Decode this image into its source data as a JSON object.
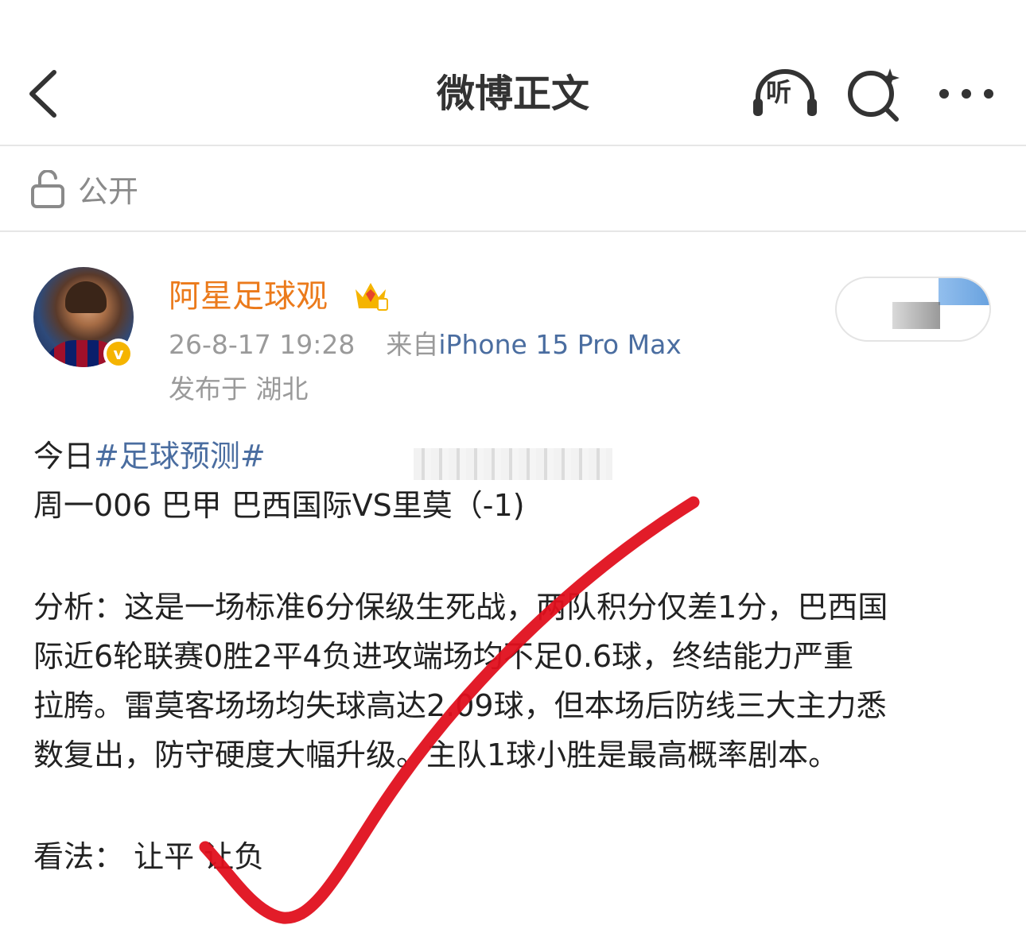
{
  "header": {
    "title": "微博正文",
    "listen_label": "听"
  },
  "visibility": {
    "label": "公开"
  },
  "post": {
    "author": "阿星足球观",
    "timestamp": "26-8-17 19:28",
    "source_prefix": "来自",
    "device": "iPhone 15 Pro Max",
    "location": "发布于 湖北",
    "intro_prefix": "今日",
    "hashtag": "#足球预测#",
    "match_line": "周一006 巴甲  巴西国际VS里莫（-1)",
    "analysis_lines": [
      "分析：这是一场标准6分保级生死战，两队积分仅差1分，巴西国",
      "际近6轮联赛0胜2平4负进攻端场均不足0.6球，终结能力严重",
      "拉胯。雷莫客场场均失球高达2.09球，但本场后防线三大主力悉",
      "数复出，防守硬度大幅升级。主队1球小胜是最高概率剧本。"
    ],
    "verdict": "看法：  让平   让负"
  },
  "colors": {
    "author_orange": "#eb7a1b",
    "link_blue": "#4a6da0",
    "checkmark_red": "#e0101e",
    "verified_gold": "#f5b400"
  }
}
